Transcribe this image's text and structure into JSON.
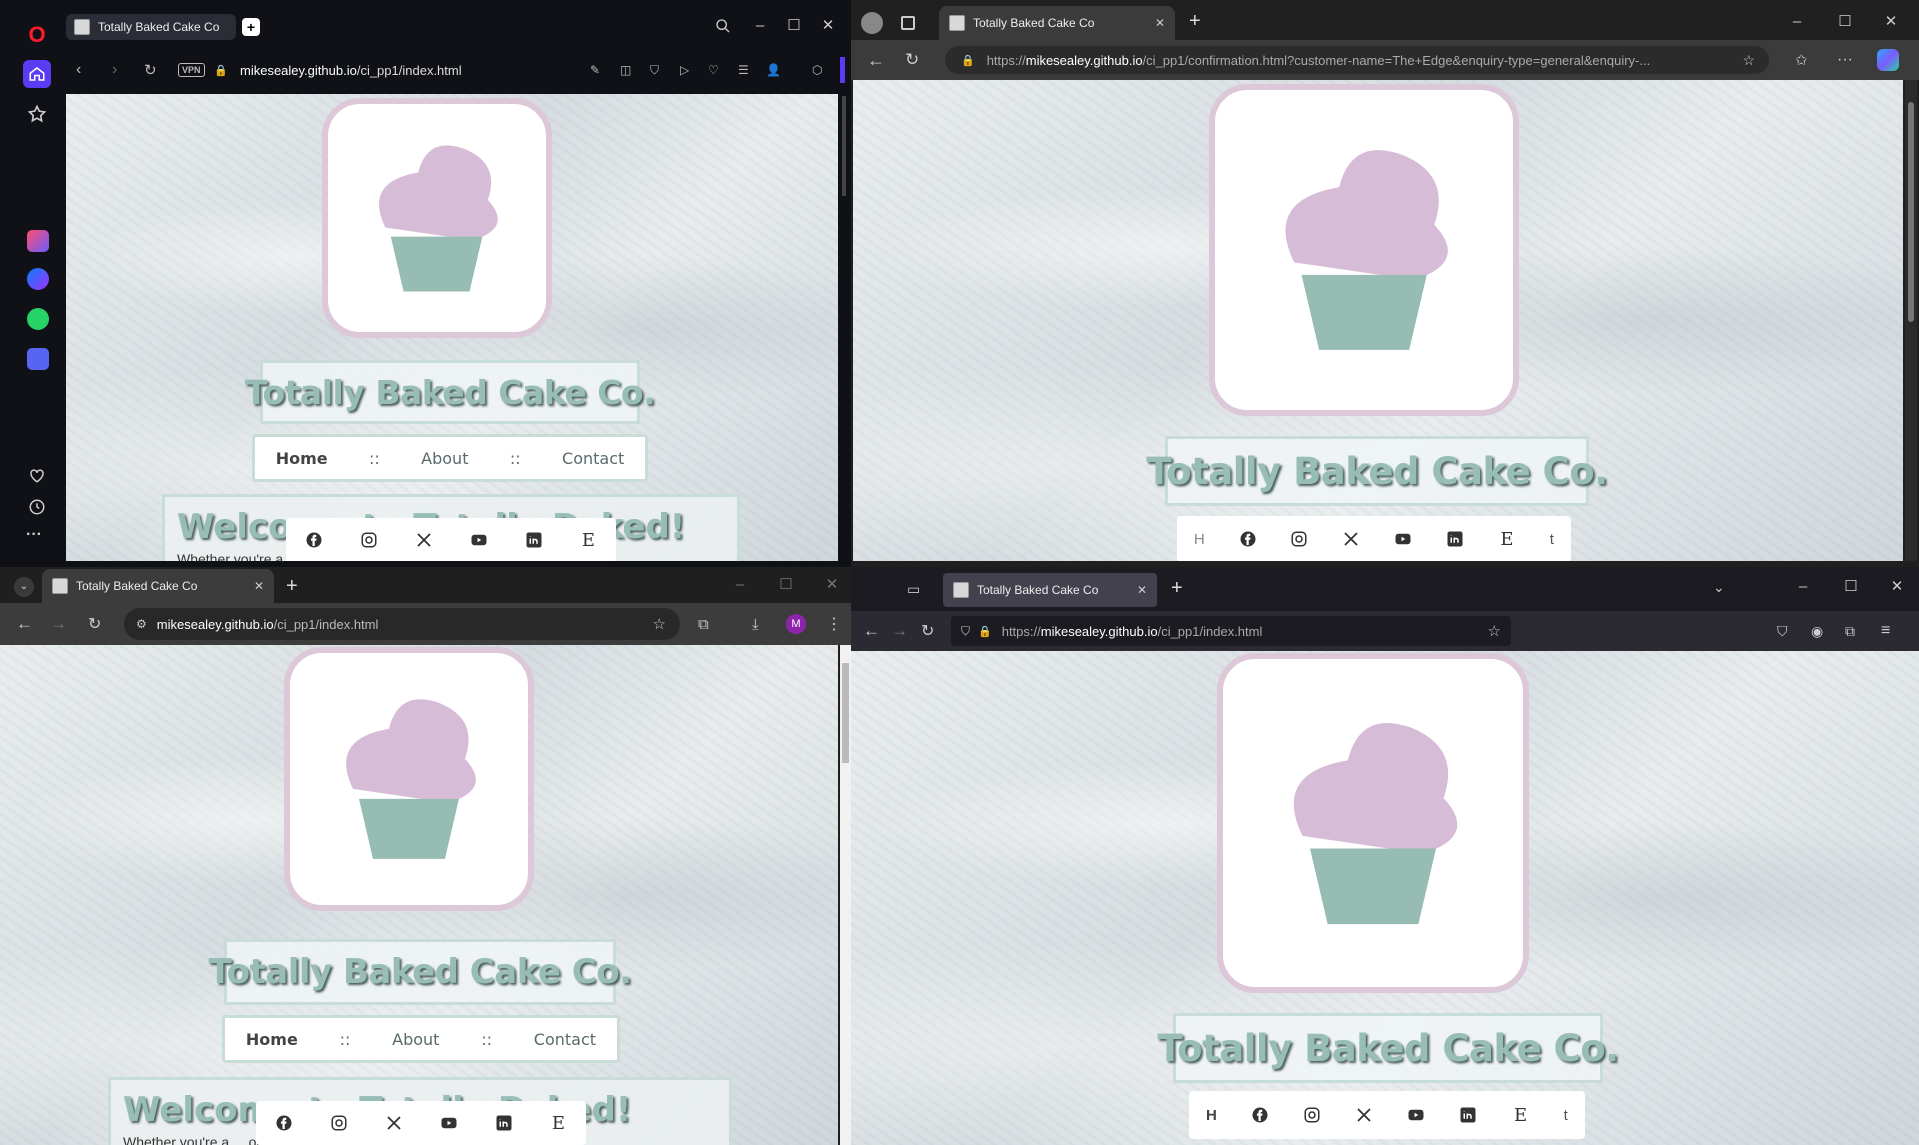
{
  "site": {
    "tab_title": "Totally Baked Cake Co",
    "site_title": "Totally Baked Cake Co.",
    "nav": [
      "Home",
      "::",
      "About",
      "::",
      "Contact"
    ],
    "welcome_heading": "Welcome to Totally Baked!",
    "welcome_text": "Whether you're a ... or you're just",
    "social": [
      "facebook-icon",
      "instagram-icon",
      "x-icon",
      "youtube-icon",
      "linkedin-icon",
      "etsy-icon"
    ],
    "etsy_glyph": "E"
  },
  "opera": {
    "url_domain": "mikesealey.github.io",
    "url_path": "/ci_pp1/index.html",
    "vpn_label": "VPN",
    "logo_glyph": "O",
    "sidebar_more": "···"
  },
  "edge": {
    "url_prefix": "https://",
    "url_domain": "mikesealey.github.io",
    "url_path": "/ci_pp1/confirmation.html?customer-name=The+Edge&enquiry-type=general&enquiry-...",
    "nav_left_fragment": "H",
    "nav_right_fragment": "t"
  },
  "chrome": {
    "url_domain": "mikesealey.github.io",
    "url_path": "/ci_pp1/index.html",
    "profile_initial": "M"
  },
  "firefox": {
    "url_prefix": "https://",
    "url_domain": "mikesealey.github.io",
    "url_path": "/ci_pp1/index.html",
    "nav_left_fragment": "H",
    "nav_right_fragment": "t"
  },
  "colors": {
    "accent_pink": "#dcc8d8",
    "accent_teal": "#97bdb6",
    "opera_red": "#ff1b2d",
    "chrome_profile": "#8e24aa"
  }
}
